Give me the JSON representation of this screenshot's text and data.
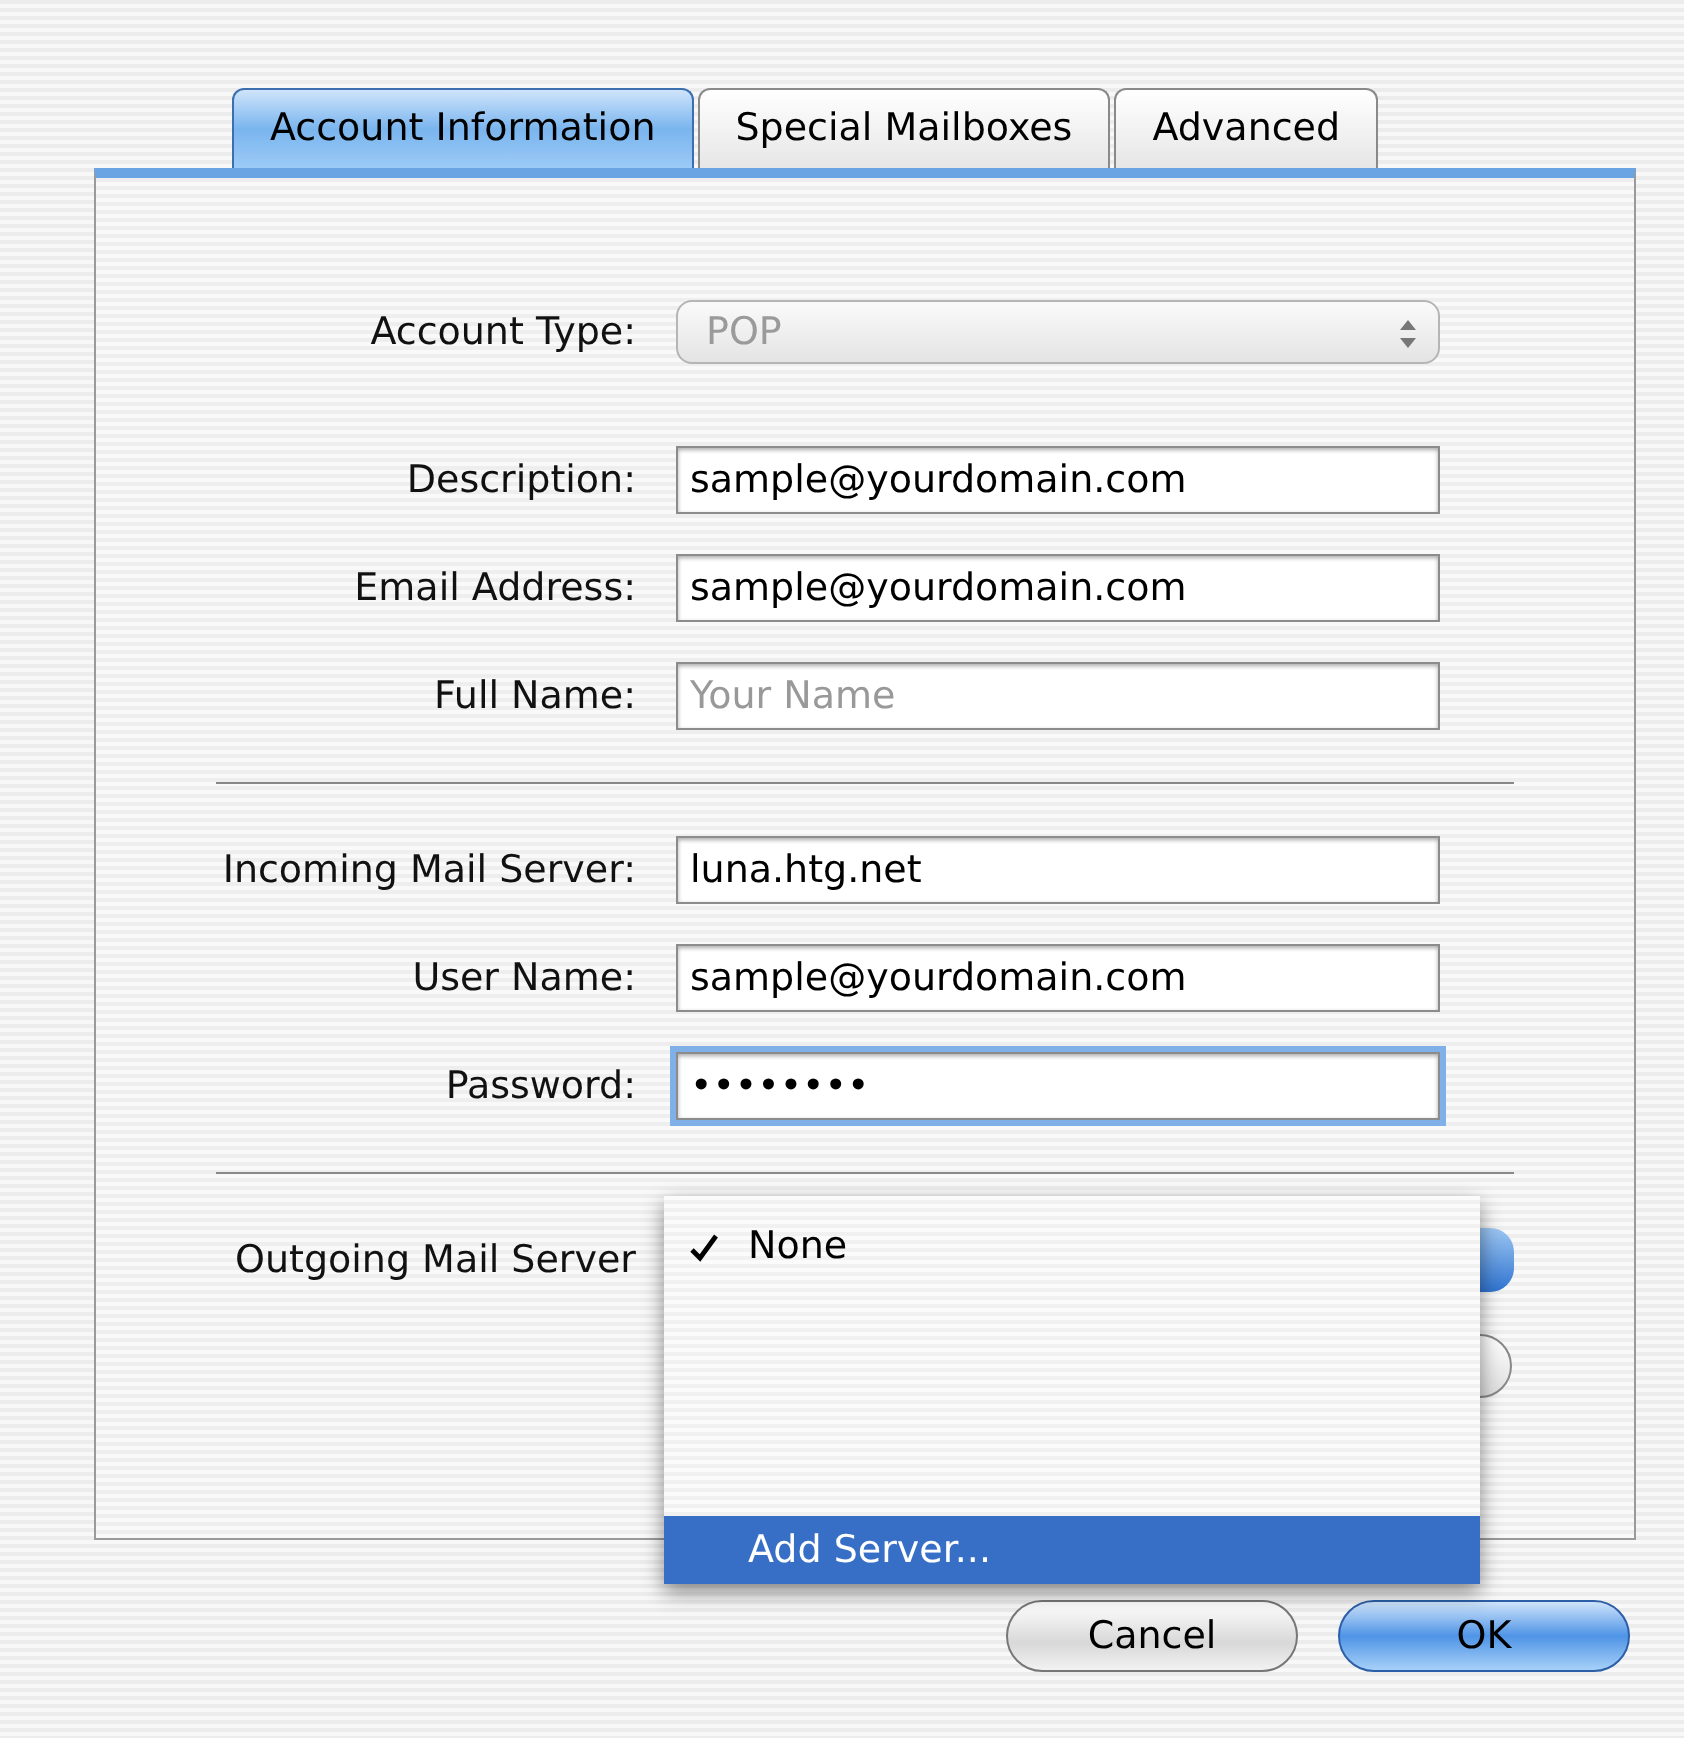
{
  "tabs": [
    {
      "label": "Account Information",
      "selected": true
    },
    {
      "label": "Special Mailboxes",
      "selected": false
    },
    {
      "label": "Advanced",
      "selected": false
    }
  ],
  "sections": [
    {
      "fields": [
        {
          "label": "Account Type:",
          "kind": "select",
          "value": "POP",
          "disabled": true
        }
      ]
    },
    {
      "fields": [
        {
          "label": "Description:",
          "kind": "text",
          "value": "sample@yourdomain.com"
        },
        {
          "label": "Email Address:",
          "kind": "text",
          "value": "sample@yourdomain.com"
        },
        {
          "label": "Full Name:",
          "kind": "text",
          "placeholder": "Your Name"
        }
      ]
    },
    {
      "fields": [
        {
          "label": "Incoming Mail Server:",
          "kind": "text",
          "value": "luna.htg.net"
        },
        {
          "label": "User Name:",
          "kind": "text",
          "value": "sample@yourdomain.com"
        },
        {
          "label": "Password:",
          "kind": "text",
          "value": "••••••••",
          "focused": true
        }
      ]
    },
    {
      "fields": [
        {
          "label": "Outgoing Mail Server",
          "kind": "popup"
        }
      ]
    }
  ],
  "menu": {
    "items": [
      {
        "label": "None",
        "checked": true,
        "selected": false
      },
      {
        "label": "Add Server...",
        "checked": false,
        "selected": true
      }
    ]
  },
  "buttons": [
    {
      "label": "Cancel",
      "default": false
    },
    {
      "label": "OK",
      "default": true
    }
  ]
}
